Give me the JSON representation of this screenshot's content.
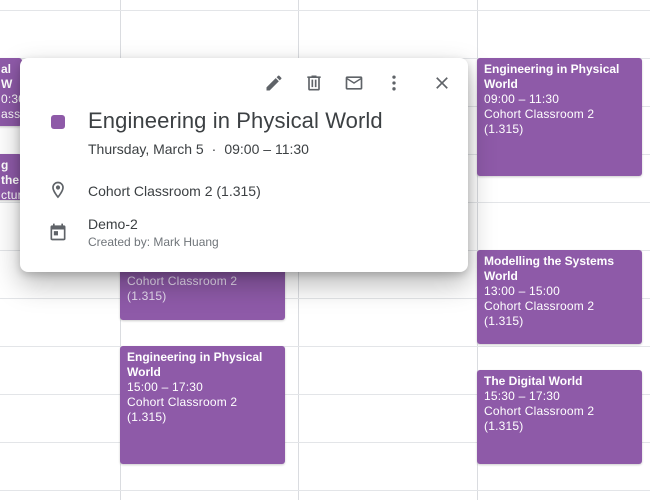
{
  "popover": {
    "title": "Engineering in Physical World",
    "date": "Thursday, March 5",
    "separator": "·",
    "time": "09:00 – 11:30",
    "location": "Cohort Classroom 2 (1.315)",
    "calendar": "Demo-2",
    "created_by": "Created by: Mark Huang",
    "color": "#8e5aa8",
    "actions": [
      "edit-icon",
      "delete-icon",
      "email-icon",
      "more-options-icon",
      "close-icon"
    ]
  },
  "events": [
    {
      "lines": [
        "al W",
        "0:30",
        "ass"
      ]
    },
    {
      "lines": [
        "g the",
        "ctur"
      ]
    },
    {
      "title": "",
      "lines": [
        "Cohort Classroom 2 (1.315)"
      ]
    },
    {
      "title": "Engineering in Physical World",
      "lines": [
        "15:00 – 17:30",
        "Cohort Classroom 2 (1.315)"
      ]
    },
    {
      "title": "Engineering in Physical World",
      "lines": [
        "09:00 – 11:30",
        "Cohort Classroom 2 (1.315)"
      ]
    },
    {
      "title": "Modelling the Systems World",
      "lines": [
        "13:00 – 15:00",
        "Cohort Classroom 2 (1.315)"
      ]
    },
    {
      "title": "The Digital World",
      "lines": [
        "15:30 – 17:30",
        "Cohort Classroom 2 (1.315)"
      ]
    }
  ]
}
